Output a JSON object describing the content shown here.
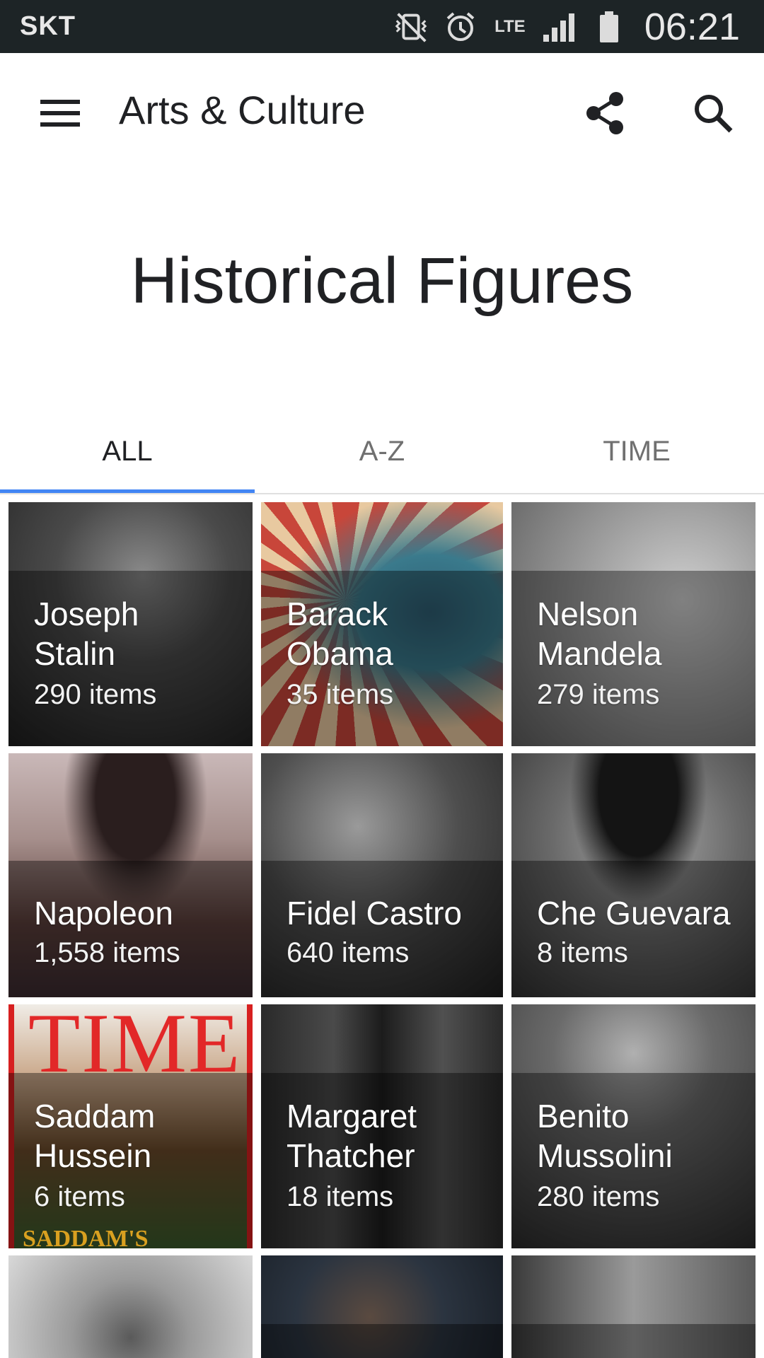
{
  "status_bar": {
    "carrier": "SKT",
    "network": "LTE",
    "time": "06:21",
    "icons": [
      "vibrate-mute-icon",
      "alarm-icon",
      "signal-icon",
      "battery-icon"
    ]
  },
  "app_bar": {
    "title": "Arts & Culture",
    "icons": [
      "menu-icon",
      "share-icon",
      "search-icon"
    ]
  },
  "page": {
    "title": "Historical Figures"
  },
  "tabs": [
    {
      "label": "ALL",
      "active": true
    },
    {
      "label": "A-Z",
      "active": false
    },
    {
      "label": "TIME",
      "active": false
    }
  ],
  "accent_color": "#4285f4",
  "tiles": [
    {
      "name_lines": [
        "Joseph",
        "Stalin"
      ],
      "count": "290 items",
      "tone": "#3a3a3a"
    },
    {
      "name_lines": [
        "Barack",
        "Obama"
      ],
      "count": "35 items",
      "tone": "#b33a30"
    },
    {
      "name_lines": [
        "Nelson",
        "Mandela"
      ],
      "count": "279 items",
      "tone": "#9a9a9a"
    },
    {
      "name_lines": [
        "Napoleon"
      ],
      "count": "1,558 items",
      "tone": "#9c7a78"
    },
    {
      "name_lines": [
        "Fidel Castro"
      ],
      "count": "640 items",
      "tone": "#4a4a4a"
    },
    {
      "name_lines": [
        "Che Guevara"
      ],
      "count": "8 items",
      "tone": "#6a6a6a"
    },
    {
      "name_lines": [
        "Saddam",
        "Hussein"
      ],
      "count": "6 items",
      "tone": "#6d5a3a",
      "cover_text": "TIME",
      "cover_sub": "SADDAM'S"
    },
    {
      "name_lines": [
        "Margaret",
        "Thatcher"
      ],
      "count": "18 items",
      "tone": "#353535"
    },
    {
      "name_lines": [
        "Benito",
        "Mussolini"
      ],
      "count": "280 items",
      "tone": "#5a5a5a"
    },
    {
      "name_lines": [],
      "count": "",
      "tone": "#8c8c8c"
    },
    {
      "name_lines": [],
      "count": "",
      "tone": "#2b3440"
    },
    {
      "name_lines": [],
      "count": "",
      "tone": "#7a7a7a"
    }
  ]
}
